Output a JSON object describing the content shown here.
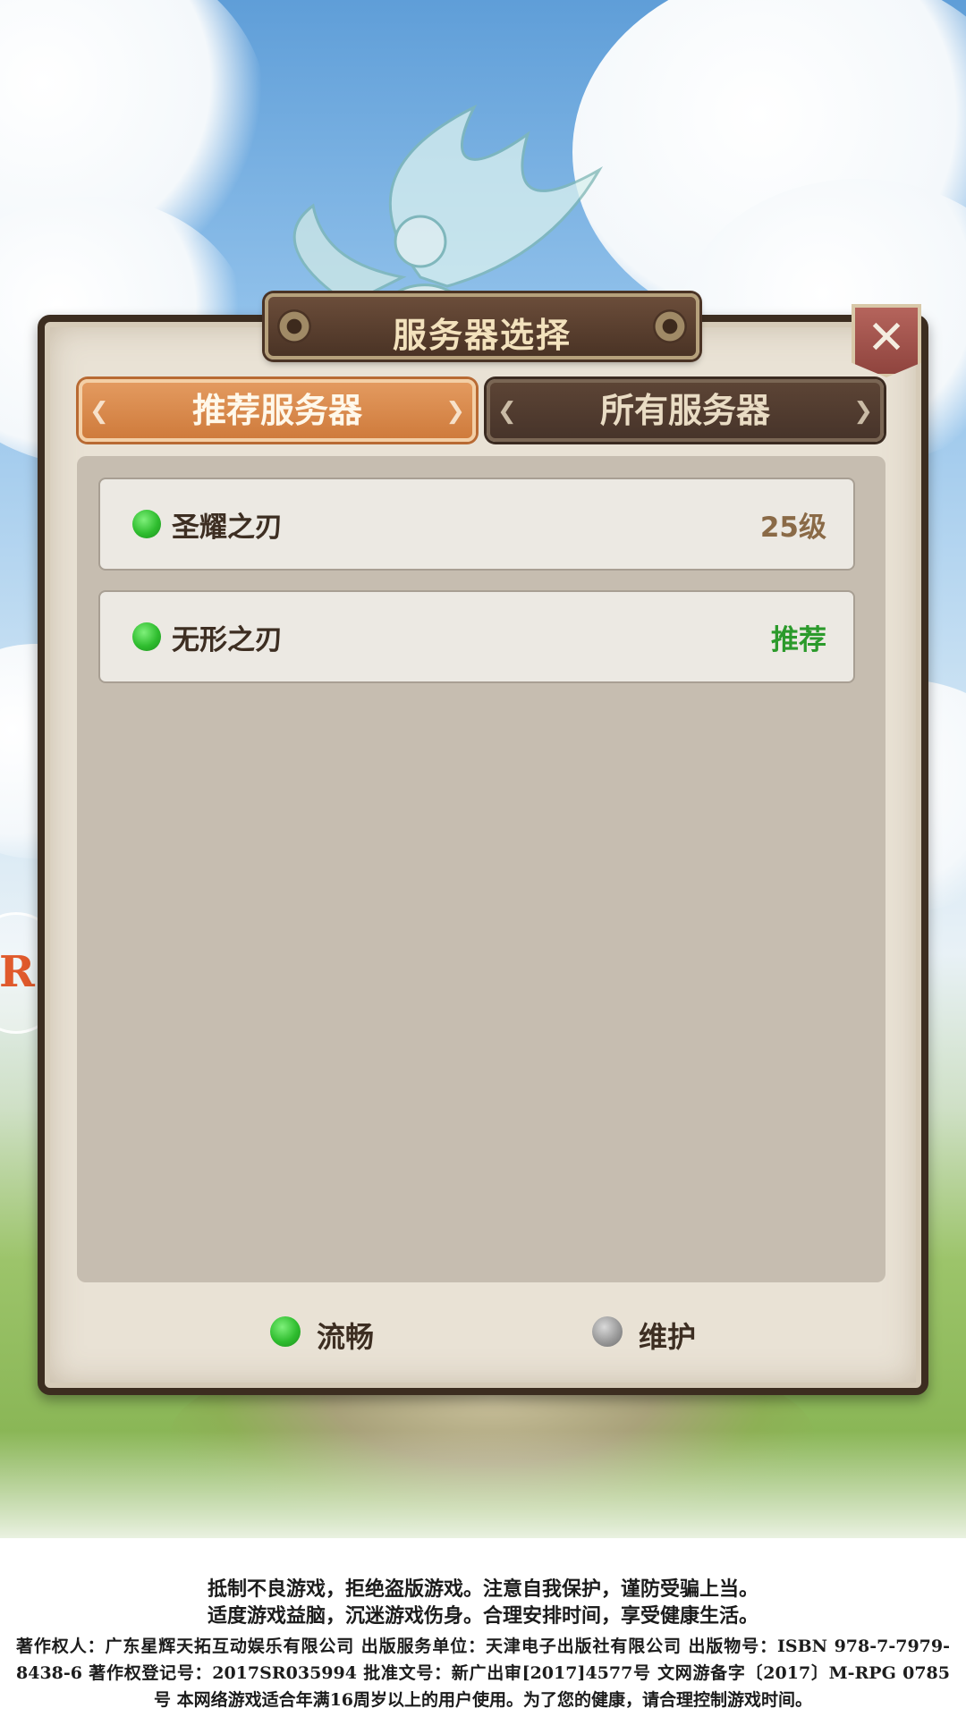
{
  "dialog": {
    "title": "服务器选择",
    "close_icon": "close-icon"
  },
  "tabs": [
    {
      "label": "推荐服务器",
      "active": true
    },
    {
      "label": "所有服务器",
      "active": false
    }
  ],
  "servers": [
    {
      "name": "圣耀之刃",
      "status": "流畅",
      "tag": "25级"
    },
    {
      "name": "无形之刃",
      "status": "流畅",
      "tag": "推荐"
    }
  ],
  "legend": {
    "smooth_label": "流畅",
    "maintenance_label": "维护"
  },
  "colors": {
    "status_smooth": "#2fbd2f",
    "status_maintenance": "#9a9a9a",
    "tab_active": "#d98743",
    "tab_inactive": "#4f3a2e",
    "recommend_text": "#2b9a2b"
  },
  "footer": {
    "line1": "抵制不良游戏，拒绝盗版游戏。注意自我保护，谨防受骗上当。",
    "line2": "适度游戏益脑，沉迷游戏伤身。合理安排时间，享受健康生活。",
    "line3": "著作权人：广东星辉天拓互动娱乐有限公司  出版服务单位：天津电子出版社有限公司  出版物号：ISBN 978-7-7979-8438-6  著作权登记号：2017SR035994  批准文号：新广出审[2017]4577号  文网游备字〔2017〕M-RPG 0785 号  本网络游戏适合年满16周岁以上的用户使用。为了您的健康，请合理控制游戏时间。"
  }
}
